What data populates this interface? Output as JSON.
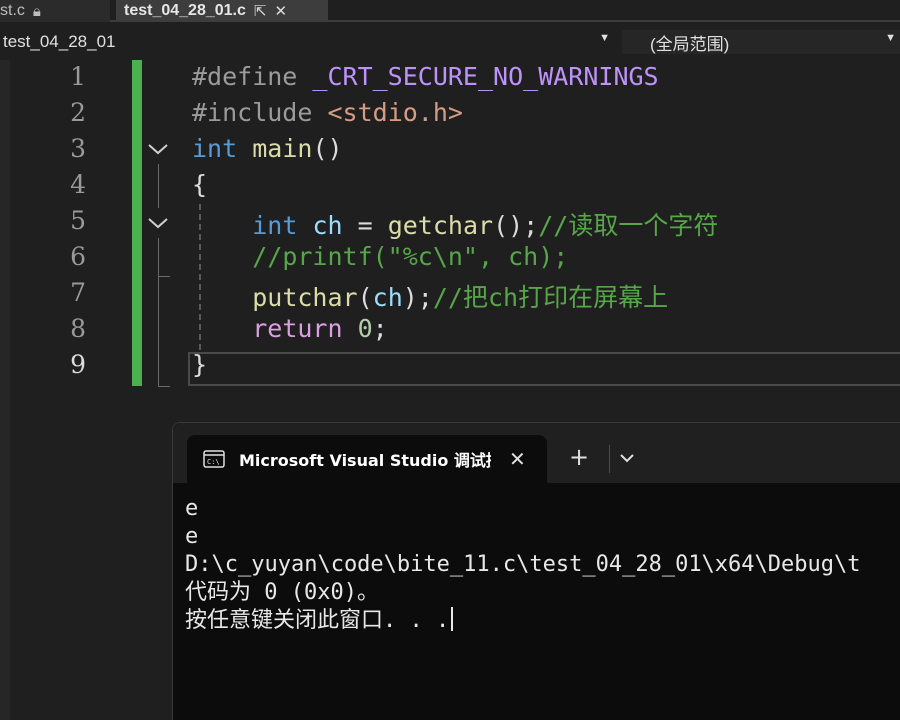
{
  "tabs": [
    {
      "label": "st.c",
      "active": false
    },
    {
      "label": "test_04_28_01.c",
      "active": true
    }
  ],
  "tab_icons": {
    "lock": "lock-icon",
    "pin": "pin-icon",
    "close": "close-icon"
  },
  "navbar": {
    "file_scope": "test_04_28_01",
    "member_scope": "(全局范围)"
  },
  "line_numbers": [
    "1",
    "2",
    "3",
    "4",
    "5",
    "6",
    "7",
    "8",
    "9"
  ],
  "current_line": "9",
  "code": {
    "l1_directive": "#define",
    "l1_macro": "_CRT_SECURE_NO_WARNINGS",
    "l2_directive": "#include",
    "l2_header": "<stdio.h>",
    "l3_type": "int",
    "l3_fn": "main",
    "l3_parens": "()",
    "l4_brace": "{",
    "l5_type": "int",
    "l5_var": "ch",
    "l5_eq": " = ",
    "l5_fn": "getchar",
    "l5_call": "();",
    "l5_comment": "//读取一个字符",
    "l6_comment": "//printf(\"%c\\n\", ch);",
    "l7_fn": "putchar",
    "l7_open": "(",
    "l7_var": "ch",
    "l7_close": ");",
    "l7_comment": "//把ch打印在屏幕上",
    "l8_kw": "return",
    "l8_num": "0",
    "l8_semi": ";",
    "l9_brace": "}"
  },
  "colors": {
    "change_bar": "#4caf50",
    "keyword": "#569cd6",
    "comment": "#57a64a",
    "function": "#dcdcaa",
    "string": "#d69d85",
    "macro": "#bd93f9"
  },
  "terminal": {
    "tab_title": "Microsoft Visual Studio 调试控",
    "icon": "console-icon",
    "new_tab": "+",
    "output": [
      "e",
      "e",
      "D:\\c_yuyan\\code\\bite_11.c\\test_04_28_01\\x64\\Debug\\t",
      "代码为 0 (0x0)。",
      "按任意键关闭此窗口. . ."
    ]
  }
}
